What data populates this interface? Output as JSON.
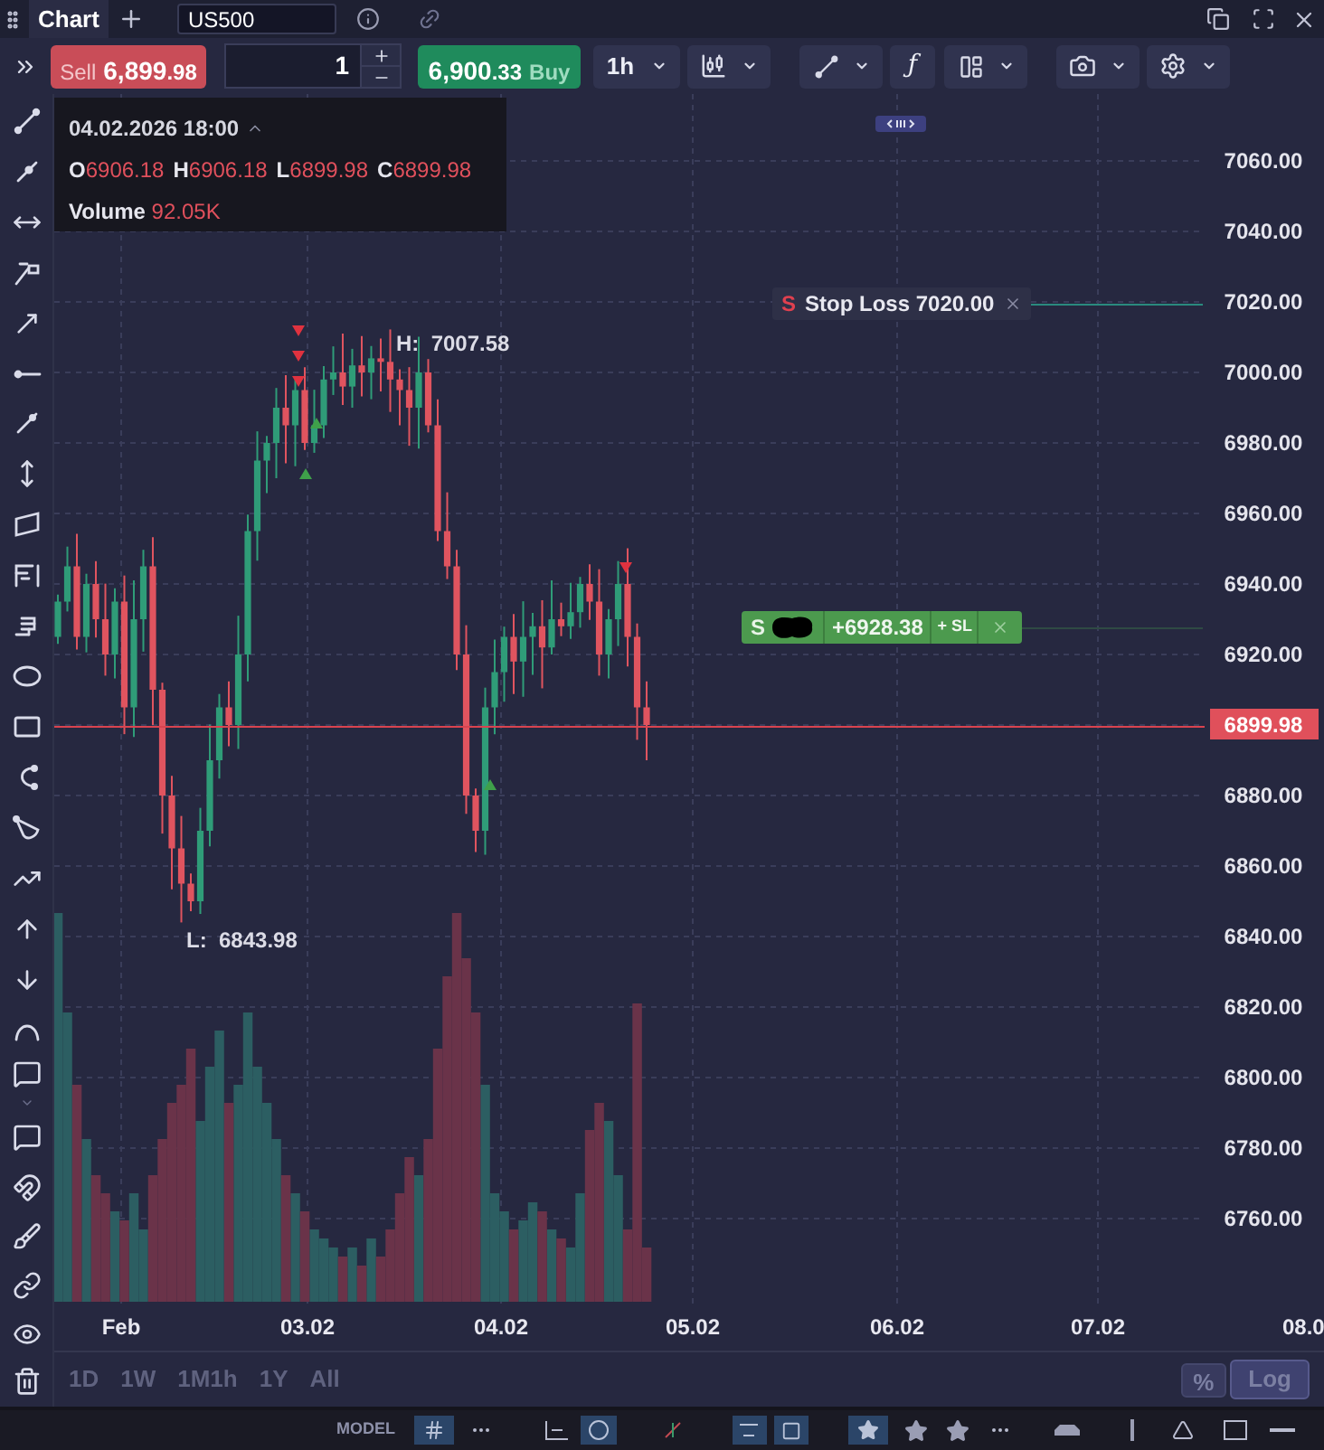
{
  "title_bar": {
    "tab": "Chart",
    "symbol": "US500"
  },
  "trade_bar": {
    "sell": {
      "label": "Sell",
      "price": "6,899",
      "fraction": ".98"
    },
    "quantity": "1",
    "buy": {
      "price": "6,900",
      "fraction": ".33",
      "label": "Buy"
    },
    "timeframe": "1h",
    "indicators": "ƒ"
  },
  "ohlc": {
    "datetime": "04.02.2026 18:00",
    "fields": [
      {
        "label": "O",
        "value": "6906.18"
      },
      {
        "label": "H",
        "value": "6906.18"
      },
      {
        "label": "L",
        "value": "6899.98"
      },
      {
        "label": "C",
        "value": "6899.98"
      }
    ],
    "volume_label": "Volume",
    "volume": "92.05K"
  },
  "chart": {
    "high_label": "H:  7007.58",
    "low_label": "L:  6843.98",
    "price_axis": [
      {
        "kind": "tick",
        "label": "7060.00"
      },
      {
        "kind": "tick",
        "label": "7040.00"
      },
      {
        "kind": "tick",
        "label": "7020.00"
      },
      {
        "kind": "tick",
        "label": "7000.00"
      },
      {
        "kind": "tick",
        "label": "6980.00"
      },
      {
        "kind": "tick",
        "label": "6960.00"
      },
      {
        "kind": "tick",
        "label": "6940.00"
      },
      {
        "kind": "tick",
        "label": "6920.00"
      },
      {
        "kind": "current",
        "label": "6899.98"
      },
      {
        "kind": "tick",
        "label": "6880.00"
      },
      {
        "kind": "tick",
        "label": "6860.00"
      },
      {
        "kind": "tick",
        "label": "6840.00"
      },
      {
        "kind": "tick",
        "label": "6820.00"
      },
      {
        "kind": "tick",
        "label": "6800.00"
      },
      {
        "kind": "tick",
        "label": "6780.00"
      },
      {
        "kind": "tick",
        "label": "6760.00"
      }
    ],
    "time_axis": [
      "Feb",
      "03.02",
      "04.02",
      "05.02",
      "06.02",
      "07.02",
      "08.0"
    ]
  },
  "orders": [
    {
      "kind": "stop_loss",
      "marker": "S",
      "label": "Stop Loss 7020.00"
    },
    {
      "kind": "position",
      "marker": "S",
      "pnl": "+6928.38",
      "action": "+ SL"
    }
  ],
  "ranges": [
    "1D",
    "1W",
    "1M1h",
    "1Y",
    "All"
  ],
  "scale_buttons": [
    {
      "label": "%",
      "selected": false
    },
    {
      "label": "Log",
      "selected": true
    }
  ],
  "bottom_strip": {
    "label": "MODEL"
  }
}
